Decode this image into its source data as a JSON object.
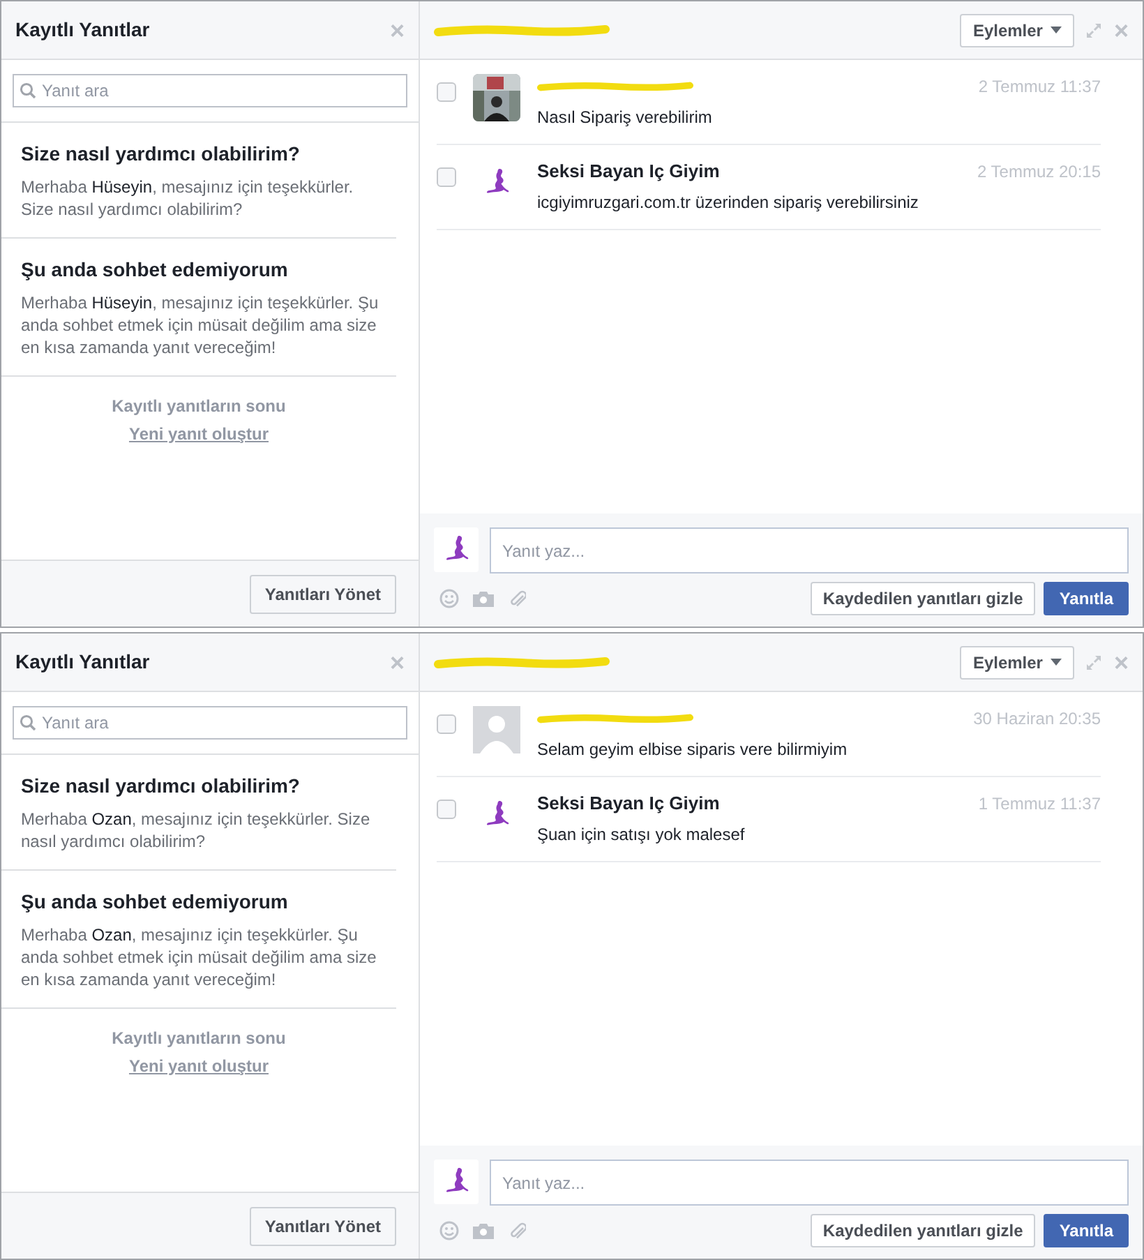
{
  "panels": [
    {
      "saved_replies": {
        "title": "Kayıtlı Yanıtlar",
        "close": "×",
        "search_placeholder": "Yanıt ara",
        "replies": [
          {
            "title": "Size nasıl yardımcı olabilirim?",
            "body": "Merhaba **Hüseyin**, mesajınız için teşekkürler. Size nasıl yardımcı olabilirim?"
          },
          {
            "title": "Şu anda sohbet edemiyorum",
            "body": "Merhaba **Hüseyin**, mesajınız için teşekkürler. Şu anda sohbet etmek için müsait değilim ama size en kısa zamanda yanıt vereceğim!"
          }
        ],
        "end_text": "Kayıtlı yanıtların sonu",
        "create_link": "Yeni yanıt oluştur",
        "manage_button": "Yanıtları Yönet"
      },
      "conversation": {
        "title_redacted": true,
        "actions_button": "Eylemler",
        "close": "×",
        "messages": [
          {
            "kind": "customer",
            "checked": false,
            "time": "2 Temmuz 11:37",
            "text": "Nasıl Sipariş verebilirim"
          },
          {
            "kind": "page",
            "avatar": {
              "kind": "logo"
            },
            "checked": false,
            "sender": "Seksi Bayan Iç Giyim",
            "time": "2 Temmuz 20:15",
            "text": "icgiyimruzgari.com.tr üzerinden sipariş verebilirsiniz"
          }
        ],
        "composer": {
          "placeholder": "Yanıt yaz...",
          "hide_button": "Kaydedilen yanıtları gizle",
          "send_button": "Yanıtla"
        }
      }
    },
    {
      "saved_replies": {
        "title": "Kayıtlı Yanıtlar",
        "close": "×",
        "search_placeholder": "Yanıt ara",
        "replies": [
          {
            "title": "Size nasıl yardımcı olabilirim?",
            "body": "Merhaba **Ozan**, mesajınız için teşekkürler. Size nasıl yardımcı olabilirim?"
          },
          {
            "title": "Şu anda sohbet edemiyorum",
            "body": "Merhaba **Ozan**, mesajınız için teşekkürler. Şu anda sohbet etmek için müsait değilim ama size en kısa zamanda yanıt vereceğim!"
          }
        ],
        "end_text": "Kayıtlı yanıtların sonu",
        "create_link": "Yeni yanıt oluştur",
        "manage_button": "Yanıtları Yönet"
      },
      "conversation": {
        "title_redacted": true,
        "actions_button": "Eylemler",
        "close": "×",
        "messages": [
          {
            "kind": "customer",
            "avatar": {
              "kind": "silhouette"
            },
            "checked": false,
            "time": "30 Haziran 20:35",
            "text": "Selam geyim elbise siparis vere bilirmiyim"
          },
          {
            "kind": "page",
            "avatar": {
              "kind": "logo"
            },
            "checked": false,
            "sender": "Seksi Bayan Iç Giyim",
            "time": "1 Temmuz 11:37",
            "text": "Şuan için satışı yok malesef"
          }
        ],
        "composer": {
          "placeholder": "Yanıt yaz...",
          "hide_button": "Kaydedilen yanıtları gizle",
          "send_button": "Yanıtla"
        }
      }
    }
  ]
}
